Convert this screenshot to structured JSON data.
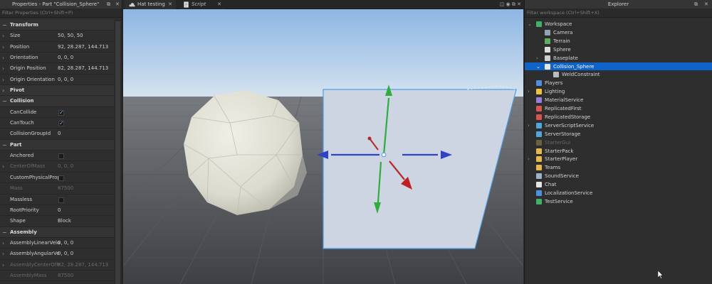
{
  "properties": {
    "title": "Properties - Part \"Collision_Sphere\"",
    "filter_placeholder": "Filter Properties (Ctrl+Shift+P)",
    "rows": [
      {
        "type": "section",
        "label": "Transform"
      },
      {
        "type": "prop",
        "label": "Size",
        "value": "50, 50, 50",
        "expand": true
      },
      {
        "type": "prop",
        "label": "Position",
        "value": "92, 28.287, 144.713",
        "expand": true
      },
      {
        "type": "prop",
        "label": "Orientation",
        "value": "0, 0, 0",
        "expand": true
      },
      {
        "type": "prop",
        "label": "Origin Position",
        "value": "82, 28.287, 144.713",
        "expand": true
      },
      {
        "type": "prop",
        "label": "Origin Orientation",
        "value": "0, 0, 0",
        "expand": true
      },
      {
        "type": "section",
        "label": "Pivot",
        "collapsed": true
      },
      {
        "type": "section",
        "label": "Collision"
      },
      {
        "type": "check",
        "label": "CanCollide",
        "checked": true
      },
      {
        "type": "check",
        "label": "CanTouch",
        "checked": true
      },
      {
        "type": "prop",
        "label": "CollisionGroupId",
        "value": "0"
      },
      {
        "type": "section",
        "label": "Part"
      },
      {
        "type": "check",
        "label": "Anchored",
        "checked": false
      },
      {
        "type": "prop",
        "label": "CenterOfMass",
        "value": "0, 0, 0",
        "expand": true,
        "dim": true
      },
      {
        "type": "check",
        "label": "CustomPhysicalProperties",
        "checked": false
      },
      {
        "type": "prop",
        "label": "Mass",
        "value": "87500",
        "dim": true
      },
      {
        "type": "check",
        "label": "Massless",
        "checked": false
      },
      {
        "type": "prop",
        "label": "RootPriority",
        "value": "0"
      },
      {
        "type": "prop",
        "label": "Shape",
        "value": "Block"
      },
      {
        "type": "section",
        "label": "Assembly"
      },
      {
        "type": "prop",
        "label": "AssemblyLinearVelocity",
        "value": "0, 0, 0",
        "expand": true
      },
      {
        "type": "prop",
        "label": "AssemblyAngularVelocity",
        "value": "0, 0, 0",
        "expand": true
      },
      {
        "type": "prop",
        "label": "AssemblyCenterOfMass",
        "value": "82, 28.287, 144.713",
        "expand": true,
        "dim": true
      },
      {
        "type": "prop",
        "label": "AssemblyMass",
        "value": "87500",
        "dim": true
      }
    ]
  },
  "tabs": [
    {
      "label": "Hat testing",
      "active": true
    },
    {
      "label": "Script",
      "active": false
    }
  ],
  "explorer": {
    "title": "Explorer",
    "filter_placeholder": "Filter workspace (Ctrl+Shift+X)",
    "items": [
      {
        "label": "Workspace",
        "depth": 0,
        "arrow": "down",
        "icon": "workspace-icon",
        "color": "#3fb26a"
      },
      {
        "label": "Camera",
        "depth": 1,
        "arrow": "",
        "icon": "camera-icon",
        "color": "#8fa4b8"
      },
      {
        "label": "Terrain",
        "depth": 1,
        "arrow": "",
        "icon": "terrain-icon",
        "color": "#5fae5a"
      },
      {
        "label": "Sphere",
        "depth": 1,
        "arrow": "",
        "icon": "part-icon",
        "color": "#dcdcdc"
      },
      {
        "label": "Baseplate",
        "depth": 1,
        "arrow": "right",
        "icon": "part-icon",
        "color": "#cfcfcf"
      },
      {
        "label": "Collision_Sphere",
        "depth": 1,
        "arrow": "down",
        "icon": "part-icon",
        "color": "#e6e6e6",
        "selected": true
      },
      {
        "label": "WeldConstraint",
        "depth": 2,
        "arrow": "",
        "icon": "weld-icon",
        "color": "#bbbbbb"
      },
      {
        "label": "Players",
        "depth": 0,
        "arrow": "",
        "icon": "players-icon",
        "color": "#4d8fe0"
      },
      {
        "label": "Lighting",
        "depth": 0,
        "arrow": "right",
        "icon": "lighting-icon",
        "color": "#f0c23a"
      },
      {
        "label": "MaterialService",
        "depth": 0,
        "arrow": "",
        "icon": "material-icon",
        "color": "#9a7be0"
      },
      {
        "label": "ReplicatedFirst",
        "depth": 0,
        "arrow": "",
        "icon": "replicated-first-icon",
        "color": "#d9534f"
      },
      {
        "label": "ReplicatedStorage",
        "depth": 0,
        "arrow": "",
        "icon": "replicated-storage-icon",
        "color": "#d9534f"
      },
      {
        "label": "ServerScriptService",
        "depth": 0,
        "arrow": "right",
        "icon": "server-script-icon",
        "color": "#4ea6dc"
      },
      {
        "label": "ServerStorage",
        "depth": 0,
        "arrow": "",
        "icon": "server-storage-icon",
        "color": "#4ea6dc"
      },
      {
        "label": "StarterGui",
        "depth": 0,
        "arrow": "",
        "icon": "starter-gui-icon",
        "color": "#6b6040",
        "dim": true
      },
      {
        "label": "StarterPack",
        "depth": 0,
        "arrow": "",
        "icon": "starter-pack-icon",
        "color": "#e8b84a"
      },
      {
        "label": "StarterPlayer",
        "depth": 0,
        "arrow": "right",
        "icon": "starter-player-icon",
        "color": "#e8b84a"
      },
      {
        "label": "Teams",
        "depth": 0,
        "arrow": "",
        "icon": "teams-icon",
        "color": "#e8b84a"
      },
      {
        "label": "SoundService",
        "depth": 0,
        "arrow": "",
        "icon": "sound-icon",
        "color": "#9fb3c8"
      },
      {
        "label": "Chat",
        "depth": 0,
        "arrow": "",
        "icon": "chat-icon",
        "color": "#e6e6e6"
      },
      {
        "label": "LocalizationService",
        "depth": 0,
        "arrow": "",
        "icon": "localization-icon",
        "color": "#4d8fe0"
      },
      {
        "label": "TestService",
        "depth": 0,
        "arrow": "",
        "icon": "test-icon",
        "color": "#3fb26a"
      }
    ]
  },
  "colors": {
    "accent": "#0e63c8",
    "sky_top": "#9fc2e6",
    "ground": "#4b4d51"
  }
}
